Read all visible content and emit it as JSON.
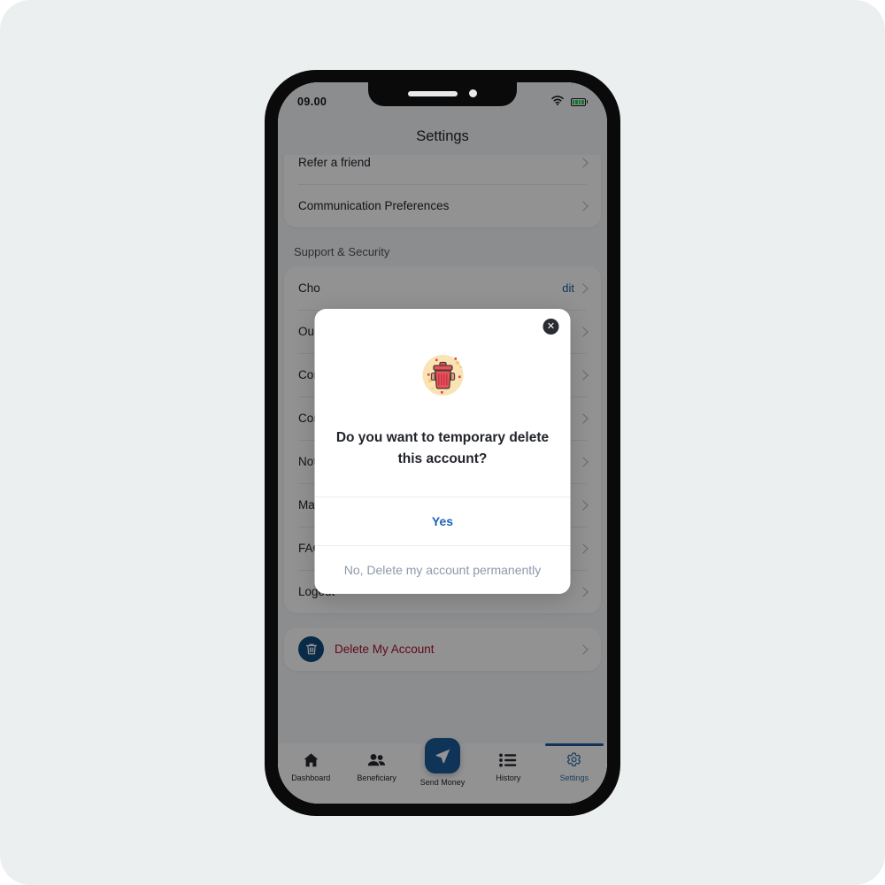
{
  "status_bar": {
    "time": "09.00",
    "wifi_icon": "wifi-icon",
    "battery_icon": "battery-icon",
    "battery_color": "#1ecb4f"
  },
  "header": {
    "title": "Settings"
  },
  "content": {
    "top_card_rows": [
      {
        "label": "Refer a friend",
        "chevron": true
      },
      {
        "label": "Communication Preferences",
        "chevron": true
      }
    ],
    "section_title": "Support & Security",
    "support_rows": [
      {
        "label": "Cho",
        "trailing": "dit",
        "chevron": true
      },
      {
        "label": "Our",
        "chevron": true
      },
      {
        "label": "Con",
        "chevron": true
      },
      {
        "label": "Con",
        "chevron": true
      },
      {
        "label": "Noti",
        "chevron": true
      },
      {
        "label": "Man",
        "chevron": true
      },
      {
        "label": "FAQ",
        "chevron": true
      },
      {
        "label": "Logout",
        "chevron": true
      }
    ],
    "delete_row": {
      "icon": "trash-icon",
      "label": "Delete My Account",
      "label_color": "#a8122e",
      "icon_bg": "#104a7c",
      "chevron": true
    }
  },
  "modal": {
    "close_label": "✕",
    "illustration": "trash-can-illustration",
    "message": "Do you want to temporary delete this account?",
    "yes_label": "Yes",
    "no_label": "No, Delete my account permanently",
    "yes_color": "#1a63b8",
    "no_color": "#8d98ab"
  },
  "bottom_nav": {
    "items": [
      {
        "label": "Dashboard",
        "icon": "home-icon",
        "active": false
      },
      {
        "label": "Beneficiary",
        "icon": "people-icon",
        "active": false
      },
      {
        "label": "Send Money",
        "icon": "paper-plane-icon",
        "active": false
      },
      {
        "label": "History",
        "icon": "list-icon",
        "active": false
      },
      {
        "label": "Settings",
        "icon": "gear-icon",
        "active": true
      }
    ],
    "active_color": "#2d6ea3",
    "fab_color": "#1a5b96"
  }
}
